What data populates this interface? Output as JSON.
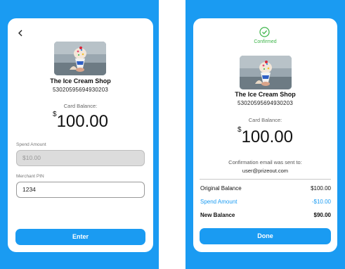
{
  "left": {
    "back_icon": "chevron-left-icon",
    "shop_name": "The Ice Cream Shop",
    "card_number": "53020595694930203",
    "balance_label": "Card Balance:",
    "currency": "$",
    "balance_amount": "100.00",
    "spend_label": "Spend Amount",
    "spend_value": "$10.00",
    "pin_label": "Merchant PIN",
    "pin_value": "1234",
    "enter_label": "Enter"
  },
  "right": {
    "check_icon": "check-circle-icon",
    "confirmed_label": "Confirmed",
    "shop_name": "The Ice Cream Shop",
    "card_number": "53020595694930203",
    "balance_label": "Card Balance:",
    "currency": "$",
    "balance_amount": "100.00",
    "email_line": "Confirmation email was sent to:",
    "email": "user@prizeout.com",
    "summary": {
      "original_label": "Original Balance",
      "original_value": "$100.00",
      "spend_label": "Spend Amount",
      "spend_value": "-$10.00",
      "new_label": "New Balance",
      "new_value": "$90.00"
    },
    "done_label": "Done"
  },
  "colors": {
    "brand_blue": "#1a9bf2",
    "success_green": "#3eb54a"
  }
}
